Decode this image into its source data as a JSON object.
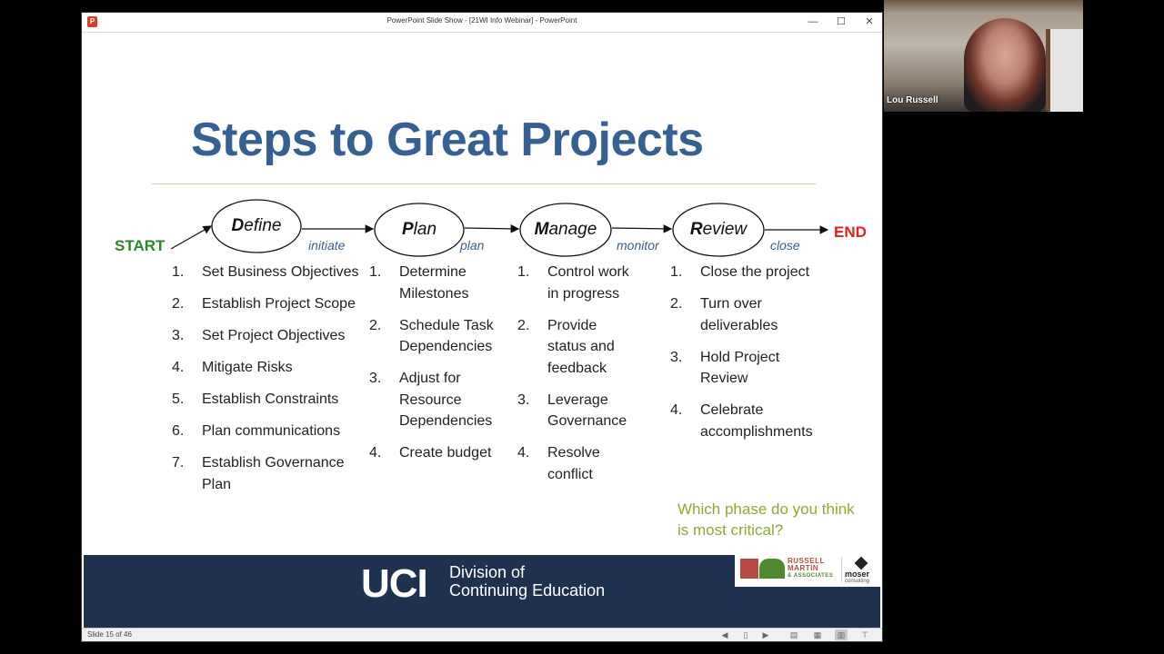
{
  "window": {
    "title": "PowerPoint Slide Show - [21WI Info Webinar] - PowerPoint",
    "app_icon": "powerpoint-icon",
    "controls": {
      "minimize": "—",
      "maximize": "☐",
      "close": "✕"
    }
  },
  "slide": {
    "title": "Steps to Great Projects",
    "start_label": "START",
    "end_label": "END",
    "phases": [
      {
        "initial": "D",
        "rest": "efine",
        "transition": "initiate"
      },
      {
        "initial": "P",
        "rest": "lan",
        "transition": "plan"
      },
      {
        "initial": "M",
        "rest": "anage",
        "transition": "monitor"
      },
      {
        "initial": "R",
        "rest": "eview",
        "transition": "close"
      }
    ],
    "columns": [
      {
        "items": [
          {
            "num": "1.",
            "text": "Set Business Objectives"
          },
          {
            "num": "2.",
            "text": "Establish Project Scope"
          },
          {
            "num": "3.",
            "text": "Set Project Objectives"
          },
          {
            "num": "4.",
            "text": "Mitigate Risks"
          },
          {
            "num": "5.",
            "text": "Establish Constraints"
          },
          {
            "num": "6.",
            "text": "Plan communications"
          },
          {
            "num": "7.",
            "text": "Establish Governance Plan"
          }
        ]
      },
      {
        "items": [
          {
            "num": "1.",
            "text": "Determine Milestones"
          },
          {
            "num": "2.",
            "text": "Schedule Task Dependencies"
          },
          {
            "num": "3.",
            "text": "Adjust for Resource Dependencies"
          },
          {
            "num": "4.",
            "text": "Create budget"
          }
        ]
      },
      {
        "items": [
          {
            "num": "1.",
            "text": "Control work in progress"
          },
          {
            "num": "2.",
            "text": "Provide status and feedback"
          },
          {
            "num": "3.",
            "text": "Leverage Governance"
          },
          {
            "num": "4.",
            "text": "Resolve conflict"
          }
        ]
      },
      {
        "items": [
          {
            "num": "1.",
            "text": "Close the project"
          },
          {
            "num": "2.",
            "text": "Turn over deliverables"
          },
          {
            "num": "3.",
            "text": "Hold Project Review"
          },
          {
            "num": "4.",
            "text": "Celebrate accomplishments"
          }
        ]
      }
    ],
    "question": "Which phase do you think is most critical?",
    "footer": {
      "logo": "UCI",
      "division_line1": "Division of",
      "division_line2": "Continuing Education",
      "partner1_name": "RUSSELL",
      "partner1_name2": "MARTIN",
      "partner1_sub": "& ASSOCIATES",
      "partner2_name": "moser",
      "partner2_sub": "consulting"
    },
    "colors": {
      "title": "#376092",
      "start": "#2a8a26",
      "end": "#e0201b",
      "transition": "#3a5f8e",
      "question": "#8bab34",
      "footer_bg": "#1e3250"
    }
  },
  "statusbar": {
    "slide_count": "Slide 15 of 46",
    "buttons": [
      {
        "name": "previous-slide-button",
        "glyph": "◀"
      },
      {
        "name": "slide-sorter-button",
        "glyph": "▯"
      },
      {
        "name": "next-slide-button",
        "glyph": "▶"
      },
      {
        "name": "normal-view-button",
        "glyph": "▤"
      },
      {
        "name": "grid-view-button",
        "glyph": "▦"
      },
      {
        "name": "reading-view-button",
        "glyph": "▥"
      },
      {
        "name": "presenter-view-button",
        "glyph": "⊤"
      }
    ]
  },
  "video": {
    "participant_name": "Lou Russell"
  }
}
